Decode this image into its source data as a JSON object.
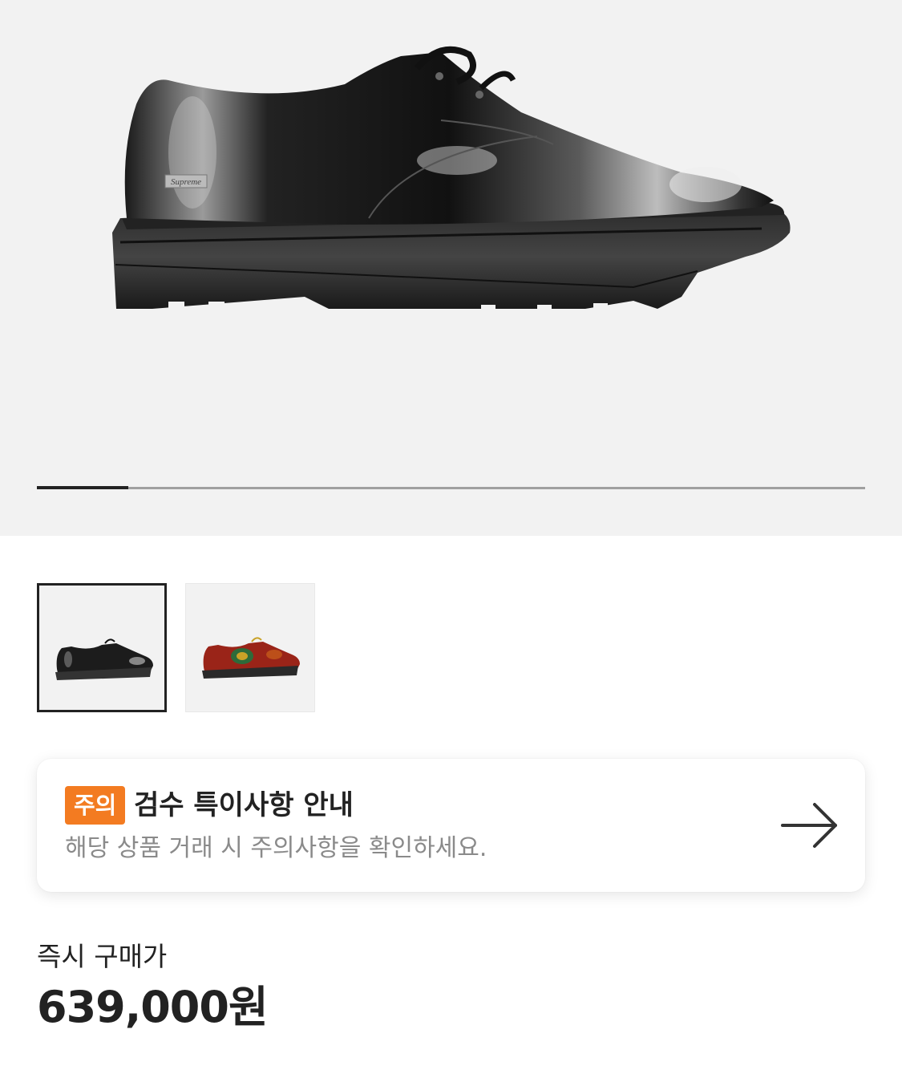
{
  "hero": {
    "image": "black-derby-shoe",
    "logo_text": "Supreme",
    "carousel": {
      "current_index": 1,
      "total": 9,
      "progress_fraction": 0.11
    }
  },
  "thumbnails": [
    {
      "image": "black-derby-shoe-thumbnail",
      "selected": true
    },
    {
      "image": "red-green-derby-shoe-thumbnail",
      "selected": false
    }
  ],
  "notice": {
    "badge": "주의",
    "title": "검수 특이사항 안내",
    "description": "해당 상품 거래 시 주의사항을 확인하세요.",
    "icon": "arrow-right-icon",
    "badge_color": "#f37b21"
  },
  "price": {
    "label": "즉시 구매가",
    "value": "639,000원"
  }
}
